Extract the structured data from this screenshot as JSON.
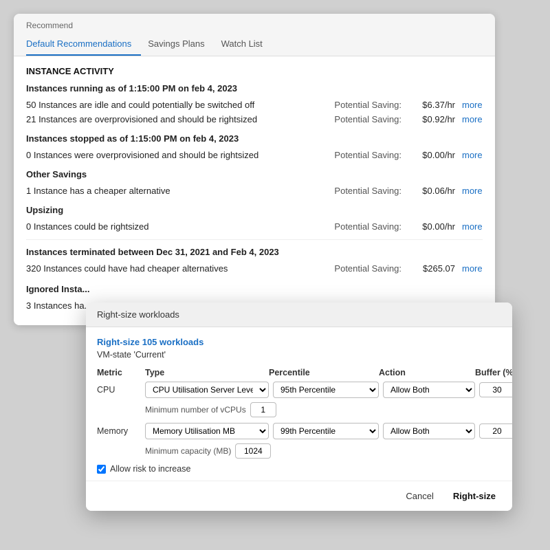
{
  "panel": {
    "title": "Recommend",
    "tabs": [
      {
        "id": "default",
        "label": "Default Recommendations",
        "active": true
      },
      {
        "id": "savings",
        "label": "Savings Plans",
        "active": false
      },
      {
        "id": "watchlist",
        "label": "Watch List",
        "active": false
      }
    ],
    "sections": [
      {
        "id": "instance_activity",
        "header": "INSTANCE ACTIVITY",
        "sub_sections": [
          {
            "id": "running",
            "sub_header": "Instances running as of 1:15:00 PM on feb 4, 2023",
            "rows": [
              {
                "label": "50 Instances are idle and could potentially be switched off",
                "saving_label": "Potential Saving:",
                "saving_value": "$6.37/hr",
                "more": "more"
              },
              {
                "label": "21 Instances are overprovisioned and should be rightsized",
                "saving_label": "Potential Saving:",
                "saving_value": "$0.92/hr",
                "more": "more"
              }
            ]
          },
          {
            "id": "stopped",
            "sub_header": "Instances stopped as of 1:15:00 PM on feb 4, 2023",
            "rows": [
              {
                "label": "0 Instances were overprovisioned and should be rightsized",
                "saving_label": "Potential Saving:",
                "saving_value": "$0.00/hr",
                "more": "more"
              }
            ]
          },
          {
            "id": "other",
            "sub_header": "Other Savings",
            "rows": [
              {
                "label": "1 Instance has a cheaper alternative",
                "saving_label": "Potential Saving:",
                "saving_value": "$0.06/hr",
                "more": "more"
              }
            ]
          },
          {
            "id": "upsizing",
            "sub_header": "Upsizing",
            "rows": [
              {
                "label": "0 Instances could be rightsized",
                "saving_label": "Potential Saving:",
                "saving_value": "$0.00/hr",
                "more": "more"
              }
            ]
          }
        ]
      },
      {
        "id": "terminated",
        "header": "Instances terminated between Dec 31, 2021 and Feb 4, 2023",
        "rows": [
          {
            "label": "320 Instances could have had cheaper alternatives",
            "saving_label": "Potential Saving:",
            "saving_value": "$265.07",
            "more": "more"
          }
        ]
      }
    ],
    "ignored": {
      "sub_header": "Ignored Insta...",
      "row_label": "3 Instances ha..."
    }
  },
  "modal": {
    "header": "Right-size workloads",
    "title_link": "Right-size 105 workloads",
    "vm_state_label": "VM-state",
    "vm_state_value": "'Current'",
    "grid_headers": {
      "metric": "Metric",
      "type": "Type",
      "percentile": "Percentile",
      "action": "Action",
      "buffer": "Buffer (%)"
    },
    "cpu_row": {
      "metric": "CPU",
      "type_value": "CPU Utilisation Server Level",
      "percentile_value": "95th Percentile",
      "action_value": "Allow Both",
      "buffer_value": "30"
    },
    "cpu_min_vcpus_label": "Minimum number of vCPUs",
    "cpu_min_vcpus_value": "1",
    "memory_row": {
      "metric": "Memory",
      "type_value": "Memory Utilisation MB",
      "percentile_value": "99th Percentile",
      "action_value": "Allow Both",
      "buffer_value": "20"
    },
    "memory_min_cap_label": "Minimum capacity (MB)",
    "memory_min_cap_value": "1024",
    "allow_risk_label": "Allow risk to increase",
    "footer": {
      "cancel_label": "Cancel",
      "rightsize_label": "Right-size"
    }
  }
}
